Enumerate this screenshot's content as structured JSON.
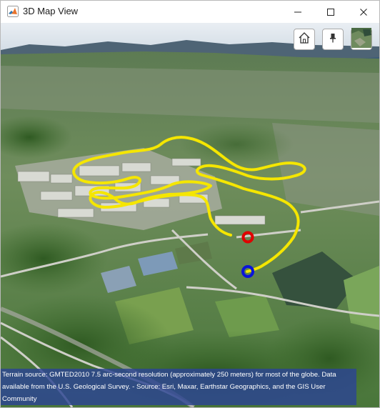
{
  "window": {
    "title": "3D Map View"
  },
  "toolbar": {
    "buttons": [
      {
        "name": "home-icon",
        "tooltip": "Home"
      },
      {
        "name": "pin-icon",
        "tooltip": "Pin"
      },
      {
        "name": "basemap-icon",
        "tooltip": "Basemap"
      }
    ]
  },
  "map": {
    "route_color": "#f5e600",
    "start_marker_color": "#e00000",
    "end_marker_color": "#0a14d8",
    "attribution": "Terrain source: GMTED2010 7.5 arc-second resolution (approximately 250 meters) for most of the globe. Data available from the U.S. Geological Survey. - Source: Esri, Maxar, Earthstar Geographics, and the GIS User Community"
  }
}
